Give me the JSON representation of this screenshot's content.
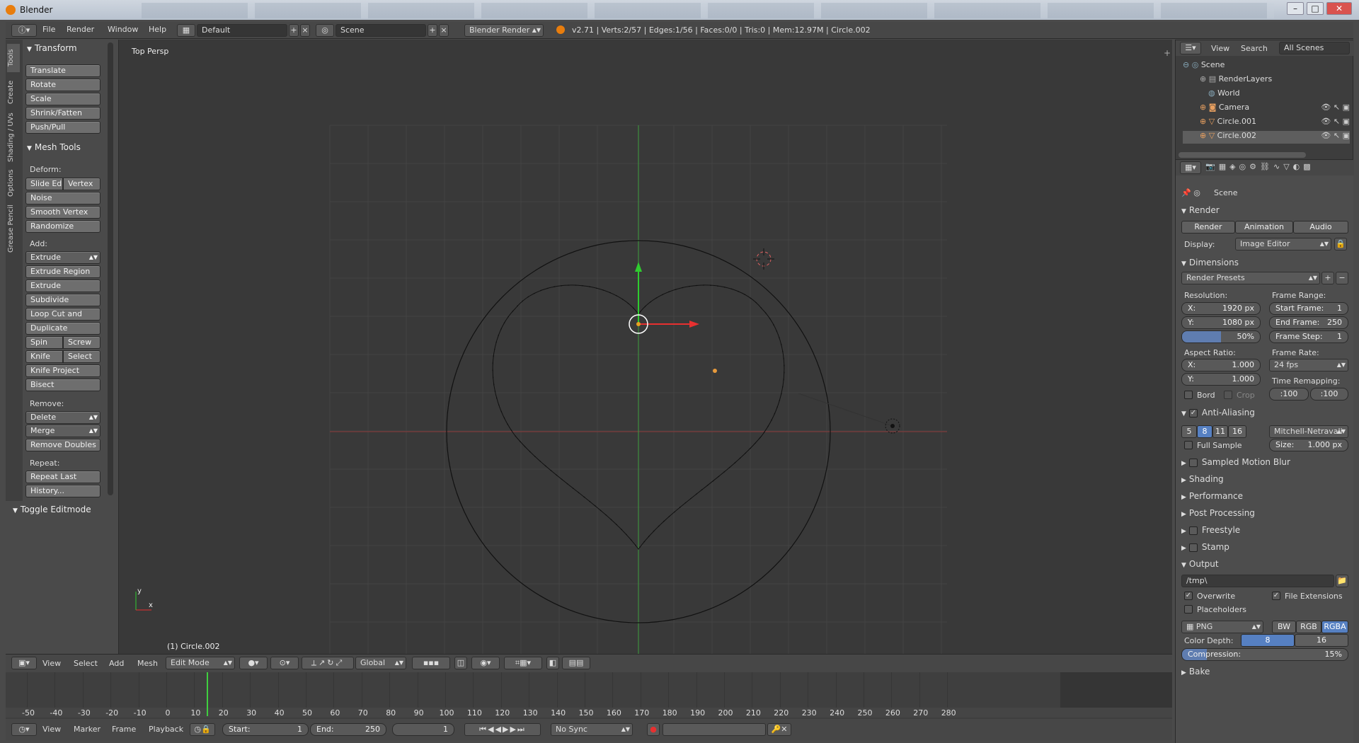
{
  "window": {
    "title": "Blender",
    "minimize": "–",
    "maximize": "□",
    "close": "✕"
  },
  "topbar": {
    "menus": [
      "File",
      "Render",
      "Window",
      "Help"
    ],
    "layout": "Default",
    "scene": "Scene",
    "engine": "Blender Render",
    "stats": "v2.71 | Verts:2/57 | Edges:1/56 | Faces:0/0 | Tris:0 | Mem:12.97M | Circle.002"
  },
  "tool_tabs": [
    "Tools",
    "Create",
    "Shading / UVs",
    "Options",
    "Grease Pencil"
  ],
  "toolshelf": {
    "transform": {
      "header": "Transform",
      "buttons": [
        "Translate",
        "Rotate",
        "Scale",
        "Shrink/Fatten",
        "Push/Pull"
      ]
    },
    "mesh_tools": {
      "header": "Mesh Tools",
      "deform_label": "Deform:",
      "slide_edge": "Slide Ed",
      "vertex": "Vertex",
      "noise": "Noise",
      "smooth_vertex": "Smooth Vertex",
      "randomize": "Randomize",
      "add_label": "Add:",
      "extrude": "Extrude",
      "extrude_region": "Extrude Region",
      "extrude_individual": "Extrude Individual",
      "subdivide": "Subdivide",
      "loop_cut": "Loop Cut and Slide",
      "duplicate": "Duplicate",
      "spin": "Spin",
      "screw": "Screw",
      "knife": "Knife",
      "select": "Select",
      "knife_project": "Knife Project",
      "bisect": "Bisect",
      "remove_label": "Remove:",
      "delete": "Delete",
      "merge": "Merge",
      "remove_doubles": "Remove Doubles",
      "repeat_label": "Repeat:",
      "repeat_last": "Repeat Last",
      "history": "History..."
    },
    "toggle_editmode": "Toggle Editmode"
  },
  "viewport": {
    "view_name": "Top Persp",
    "object_label": "(1) Circle.002",
    "axis_x": "x",
    "axis_y": "y"
  },
  "viewport_header": {
    "menus": [
      "View",
      "Select",
      "Add",
      "Mesh"
    ],
    "mode": "Edit Mode",
    "orientation": "Global"
  },
  "timeline": {
    "ticks": [
      "-50",
      "-40",
      "-30",
      "-20",
      "-10",
      "0",
      "10",
      "20",
      "30",
      "40",
      "50",
      "60",
      "70",
      "80",
      "90",
      "100",
      "110",
      "120",
      "130",
      "140",
      "150",
      "160",
      "170",
      "180",
      "190",
      "200",
      "210",
      "220",
      "230",
      "240",
      "250",
      "260",
      "270",
      "280"
    ],
    "menus": [
      "View",
      "Marker",
      "Frame",
      "Playback"
    ],
    "start_label": "Start:",
    "start": "1",
    "end_label": "End:",
    "end": "250",
    "current": "1",
    "sync": "No Sync"
  },
  "outliner": {
    "menus": [
      "View",
      "Search"
    ],
    "filter": "All Scenes",
    "items": [
      "Scene",
      "RenderLayers",
      "World",
      "Camera",
      "Circle.001",
      "Circle.002"
    ]
  },
  "properties": {
    "context": "Scene",
    "render": {
      "header": "Render",
      "render_btn": "Render",
      "animation_btn": "Animation",
      "audio_btn": "Audio",
      "display_label": "Display:",
      "display": "Image Editor"
    },
    "dimensions": {
      "header": "Dimensions",
      "presets": "Render Presets",
      "resolution_label": "Resolution:",
      "res_x": "X:",
      "res_x_val": "1920 px",
      "res_y": "Y:",
      "res_y_val": "1080 px",
      "percent": "50%",
      "frame_range_label": "Frame Range:",
      "start_frame": "Start Frame:",
      "start_frame_val": "1",
      "end_frame": "End Frame:",
      "end_frame_val": "250",
      "frame_step": "Frame Step:",
      "frame_step_val": "1",
      "aspect_label": "Aspect Ratio:",
      "asp_x": "X:",
      "asp_x_val": "1.000",
      "asp_y": "Y:",
      "asp_y_val": "1.000",
      "frame_rate_label": "Frame Rate:",
      "frame_rate": "24 fps",
      "bord": "Bord",
      "crop": "Crop",
      "time_remap_label": "Time Remapping:",
      "remap_old": ":100",
      "remap_new": ":100"
    },
    "anti_aliasing": {
      "header": "Anti-Aliasing",
      "samples": [
        "5",
        "8",
        "11",
        "16"
      ],
      "filter": "Mitchell-Netravali",
      "full_sample": "Full Sample",
      "size_label": "Size:",
      "size_val": "1.000 px"
    },
    "collapsed": [
      "Sampled Motion Blur",
      "Shading",
      "Performance",
      "Post Processing",
      "Freestyle",
      "Stamp"
    ],
    "output": {
      "header": "Output",
      "path": "/tmp\\",
      "overwrite": "Overwrite",
      "file_extensions": "File Extensions",
      "placeholders": "Placeholders",
      "format": "PNG",
      "bw": "BW",
      "rgb": "RGB",
      "rgba": "RGBA",
      "color_depth_label": "Color Depth:",
      "depth_8": "8",
      "depth_16": "16",
      "compression_label": "Compression:",
      "compression": "15%"
    },
    "bake": "Bake"
  }
}
